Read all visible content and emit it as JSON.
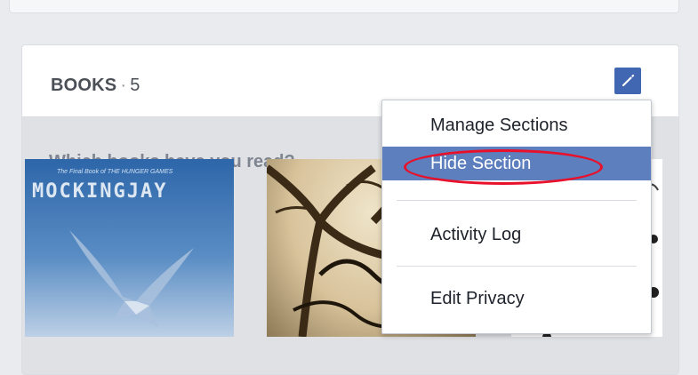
{
  "section": {
    "title": "BOOKS",
    "separator": "·",
    "count": "5",
    "prompt": "Which books have you read?"
  },
  "covers": [
    {
      "small_text": "The Final Book of THE HUNGER GAMES",
      "title": "MOCKINGJAY"
    },
    {
      "title": ""
    },
    {
      "title": ""
    }
  ],
  "menu": {
    "items": [
      {
        "label": "Manage Sections"
      },
      {
        "label": "Hide Section",
        "highlighted": true
      },
      {
        "label": "Activity Log"
      },
      {
        "label": "Edit Privacy"
      }
    ]
  },
  "colors": {
    "accent": "#4267b2",
    "highlight_row": "#5d7fbd",
    "annotation_ring": "#e8102a",
    "page_bg": "#e9ebee"
  },
  "icons": {
    "edit": "pencil-icon"
  }
}
